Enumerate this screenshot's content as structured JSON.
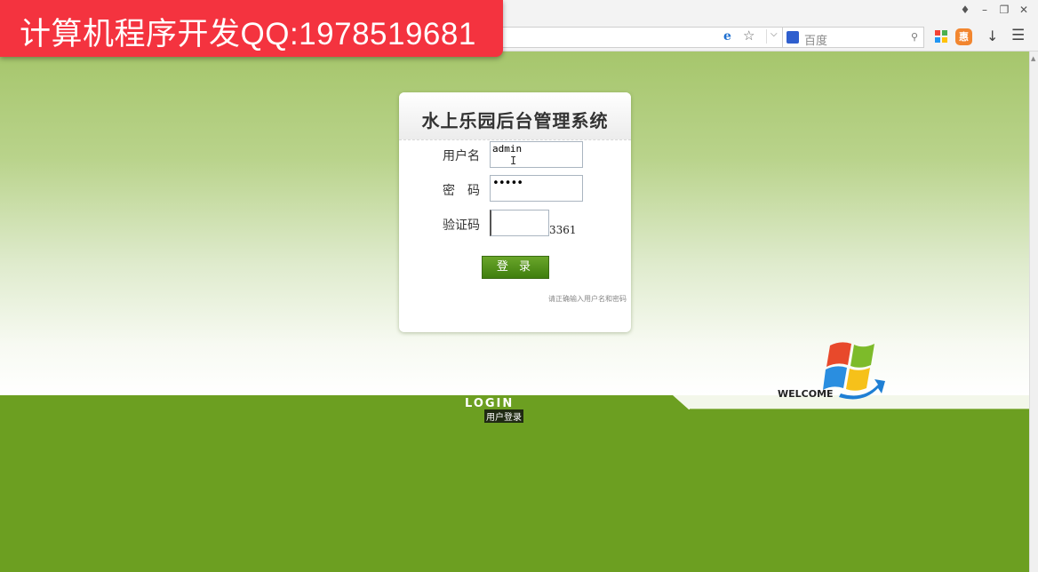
{
  "browser": {
    "window_controls": [
      "shirt",
      "minimize",
      "restore",
      "close"
    ],
    "search_engine_label": "百度",
    "ext_badge": "惠"
  },
  "watermark": {
    "text": "计算机程序开发QQ:1978519681"
  },
  "login": {
    "title": "水上乐园后台管理系统",
    "username_label": "用户名",
    "username_value": "admin",
    "password_label": "密　码",
    "password_value": "•••••",
    "captcha_label": "验证码",
    "captcha_value": "",
    "captcha_code": "3361",
    "login_button": "登 录",
    "hint": "请正确输入用户名和密码"
  },
  "footer": {
    "login_word": "LOGIN",
    "login_cn": "用户登录",
    "welcome": "WELCOME"
  },
  "colors": {
    "green_band": "#6c9f21",
    "watermark_red": "#f4333f",
    "button_green": "#4f8f18"
  }
}
